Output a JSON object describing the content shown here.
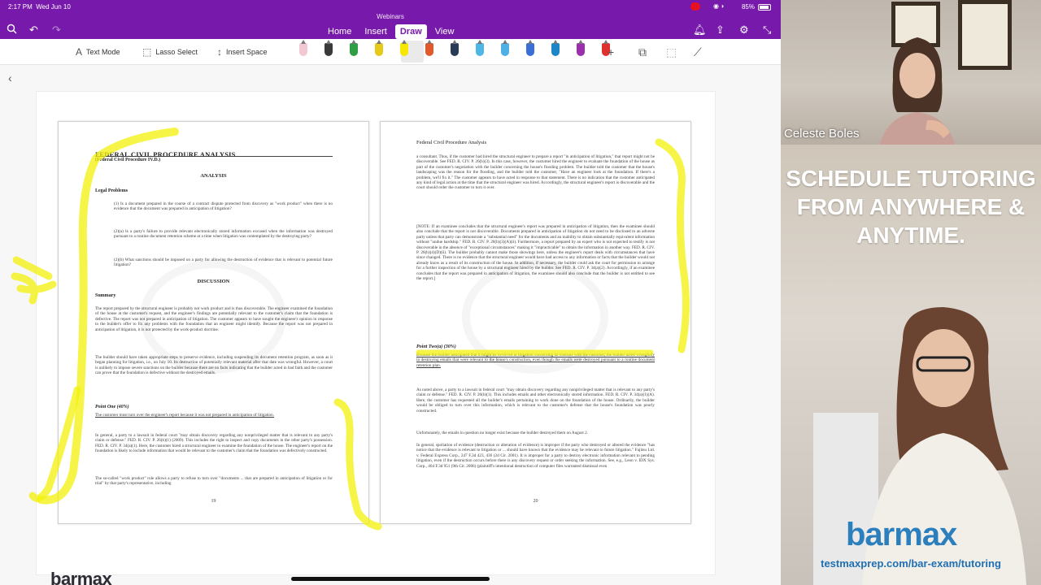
{
  "status_bar": {
    "time": "2:17 PM",
    "date": "Wed Jun 10",
    "battery": "85%"
  },
  "app": {
    "title": "Webinars"
  },
  "tabs": [
    {
      "label": "Home"
    },
    {
      "label": "Insert"
    },
    {
      "label": "Draw"
    },
    {
      "label": "View"
    }
  ],
  "toolbar": {
    "text_mode": "Text Mode",
    "lasso_select": "Lasso Select",
    "insert_space": "Insert Space"
  },
  "colors": {
    "accent": "#7719aa",
    "highlighter_yellow": "#f5f500",
    "brand_blue": "#2b7fbd"
  },
  "pens": [
    "#f2c9d3",
    "#3a3a3a",
    "#2f9e44",
    "#e8c91a",
    "#f6e700",
    "#e2582b",
    "#2a3b57",
    "#4fb7e6",
    "#4fb0e6",
    "#3a6fd8",
    "#1c86c7",
    "#9b2fae",
    "#e03131"
  ],
  "page_left": {
    "title": "FEDERAL CIVIL PROCEDURE ANALYSIS",
    "subtitle": "(Federal Civil Procedure IV.D.)",
    "analysis": "ANALYSIS",
    "legal_problems": "Legal Problems",
    "problem_1": "(1) Is a document prepared in the course of a contract dispute protected from discovery as \"work product\" when there is no evidence that the document was prepared in anticipation of litigation?",
    "problem_2": "(2)(a) Is a party's failure to provide relevant electronically stored information excused when the information was destroyed pursuant to a routine document retention scheme at a time when litigation was contemplated by the destroying party?",
    "problem_3": "(2)(b) What sanctions should be imposed on a party for allowing the destruction of evidence that is relevant to potential future litigation?",
    "discussion": "DISCUSSION",
    "summary": "Summary",
    "summary_text": "The report prepared by the structural engineer is probably not work product and is thus discoverable. The engineer examined the foundation of the house at the customer's request, and the engineer's findings are potentially relevant to the customer's claim that the foundation is defective. The report was not prepared in anticipation of litigation. The customer appears to have sought the engineer's opinion in response to the builder's offer to fix any problems with the foundation that an engineer might identify. Because the report was not prepared in anticipation of litigation, it is not protected by the work-product doctrine.",
    "summary_text_2": "The builder should have taken appropriate steps to preserve evidence, including suspending its document retention program, as soon as it began planning for litigation, i.e., on July 10. Its destruction of potentially relevant material after that date was wrongful. However, a court is unlikely to impose severe sanctions on the builder because there are no facts indicating that the builder acted in bad faith and the customer can prove that the foundation is defective without the destroyed emails.",
    "point_one": "Point One (40%)",
    "point_one_text": "The customer must turn over the engineer's report because it was not prepared in anticipation of litigation.",
    "body_text": "In general, a party to a lawsuit in federal court \"may obtain discovery regarding any nonprivileged matter that is relevant to any party's claim or defense.\" FED. R. CIV. P. 26(b)(1) (2009). This includes the right to inspect and copy documents in the other party's possession. FED. R. CIV. P. 34(a)(1). Here, the customer hired a structural engineer to examine the foundation of the house. The engineer's report on the foundation is likely to include information that would be relevant to the customer's claim that the foundation was defectively constructed.",
    "body_text_2": "The so-called \"work product\" rule allows a party to refuse to turn over \"documents ... that are prepared in anticipation of litigation or for trial\" by that party's representative, including",
    "page_number": "19"
  },
  "page_right": {
    "running_head": "Federal Civil Procedure Analysis",
    "para_1": "a consultant. Thus, if the customer had hired the structural engineer to prepare a report \"in anticipation of litigation,\" that report might not be discoverable. See FED. R. CIV. P. 26(b)(3). In this case, however, the customer hired the engineer to evaluate the foundation of the house as part of the customer's negotiation with the builder concerning the house's flooding problem. The builder told the customer that the house's landscaping was the reason for the flooding, and the builder told the customer, \"Have an engineer look at the foundation. If there's a problem, we'll fix it.\" The customer appears to have acted in response to that statement. There is no indication that the customer anticipated any kind of legal action at the time that the structural engineer was hired. Accordingly, the structural engineer's report is discoverable and the court should order the customer to turn it over.",
    "para_2": "[NOTE: If an examinee concludes that the structural engineer's report was prepared in anticipation of litigation, then the examinee should also conclude that the report is not discoverable. Documents prepared in anticipation of litigation do not need to be disclosed to an adverse party unless that party can demonstrate a \"substantial need\" for the documents and an inability to obtain substantially equivalent information without \"undue hardship.\" FED. R. CIV. P. 26(b)(3)(A)(ii). Furthermore, a report prepared by an expert who is not expected to testify is not discoverable in the absence of \"exceptional circumstances\" making it \"impracticable\" to obtain the information in another way. FED. R. CIV. P. 26(b)(4)(D)(ii). The builder probably cannot make those showings here, unless the engineer's report deals with circumstances that have since changed. There is no evidence that the structural engineer would have had access to any information or facts that the builder would not already know as a result of its construction of the house. In addition, if necessary, the builder could ask the court for permission to arrange for a further inspection of the house by a structural engineer hired by the builder. See FED. R. CIV. P. 34(a)(2). Accordingly, if an examinee concludes that the report was prepared in anticipation of litigation, the examinee should also conclude that the builder is not entitled to see the report.]",
    "point_two": "Point Two(a) (30%)",
    "point_two_text": "Because the builder anticipated that it might be involved in litigation concerning its contract with the customer, the builder acted wrongfully in destroying emails that were relevant to the house's construction, even though the emails were destroyed pursuant to a routine document retention plan.",
    "para_3": "As noted above, a party to a lawsuit in federal court \"may obtain discovery regarding any nonprivileged matter that is relevant to any party's claim or defense.\" FED. R. CIV. P. 26(b)(1). This includes emails and other electronically stored information. FED. R. CIV. P. 34(a)(1)(A). Here, the customer has requested all the builder's emails pertaining to work done on the foundation of the house. Ordinarily, the builder would be obliged to turn over this information, which is relevant to the customer's defense that the house's foundation was poorly constructed.",
    "para_4": "Unfortunately, the emails in question no longer exist because the builder destroyed them on August 2.",
    "para_5": "In general, spoliation of evidence (destruction or alteration of evidence) is improper if the party who destroyed or altered the evidence \"has notice that the evidence is relevant to litigation or ... should have known that the evidence may be relevant to future litigation.\" Fujitsu Ltd. v. Federal Express Corp., 247 F.3d 423, 436 (2d Cir. 2001). It is improper for a party to destroy electronic information relevant to pending litigation, even if the destruction occurs before there is any discovery request or order seeking the information. See, e.g., Leon v. IDX Sys. Corp., 464 F.3d 951 (9th Cir. 2006) (plaintiff's intentional destruction of computer files warranted dismissal even",
    "page_number": "20"
  },
  "webcam": {
    "name": "Celeste Boles"
  },
  "ad": {
    "headline": "SCHEDULE TUTORING FROM ANYWHERE & ANYTIME.",
    "brand": "barmax",
    "url": "testmaxprep.com/bar-exam/tutoring"
  },
  "bottom_logo": "barmax"
}
